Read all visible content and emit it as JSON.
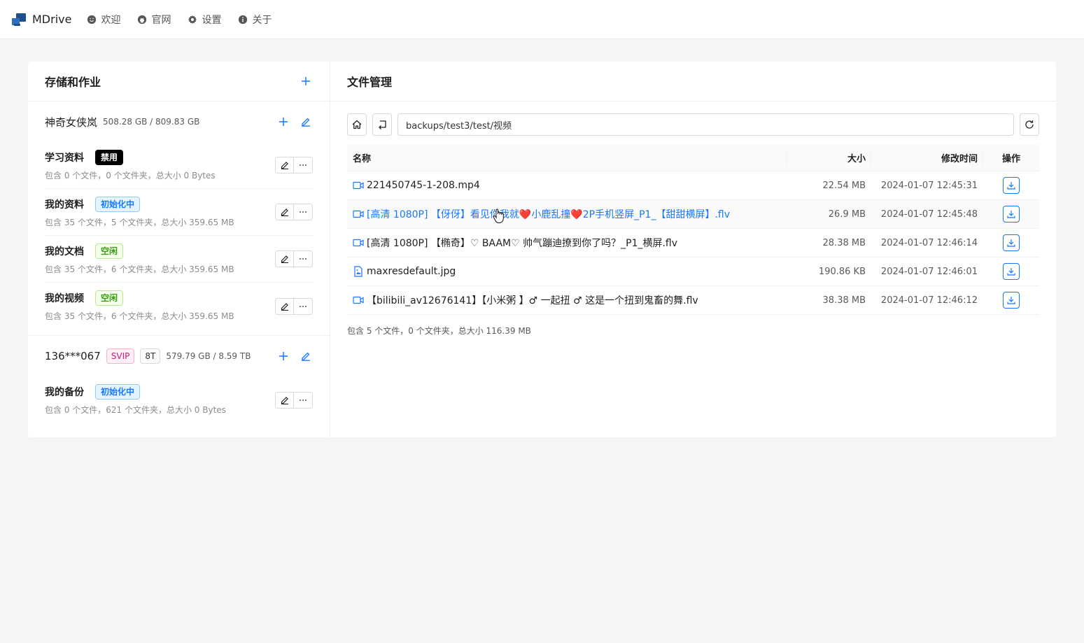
{
  "nav": {
    "brand": "MDrive",
    "items": [
      {
        "label": "欢迎",
        "icon": "smile-icon"
      },
      {
        "label": "官网",
        "icon": "github-icon"
      },
      {
        "label": "设置",
        "icon": "gear-icon"
      },
      {
        "label": "关于",
        "icon": "info-icon"
      }
    ]
  },
  "left": {
    "title": "存储和作业",
    "drives": [
      {
        "name": "神奇女侠岚",
        "size": "508.28 GB / 809.83 GB",
        "jobs": [
          {
            "name": "学习资料",
            "badge": "禁用",
            "desc": "包含 0 个文件，0 个文件夹，总大小 0 Bytes"
          },
          {
            "name": "我的资料",
            "badge": "初始化中",
            "desc": "包含 35 个文件，5 个文件夹，总大小 359.65 MB"
          },
          {
            "name": "我的文档",
            "badge": "空闲",
            "desc": "包含 35 个文件，6 个文件夹，总大小 359.65 MB"
          },
          {
            "name": "我的视频",
            "badge": "空闲",
            "desc": "包含 35 个文件，6 个文件夹，总大小 359.65 MB"
          }
        ]
      },
      {
        "name": "136***067",
        "tags": [
          "SVIP",
          "8T"
        ],
        "size": "579.79 GB / 8.59 TB",
        "jobs": [
          {
            "name": "我的备份",
            "badge": "初始化中",
            "desc": "包含 0 个文件，621 个文件夹，总大小 0 Bytes"
          }
        ]
      }
    ]
  },
  "right": {
    "title": "文件管理",
    "path": "backups/test3/test/视频",
    "columns": {
      "name": "名称",
      "size": "大小",
      "time": "修改时间",
      "op": "操作"
    },
    "files": [
      {
        "name": "221450745-1-208.mp4",
        "size": "22.54 MB",
        "time": "2024-01-07 12:45:31",
        "type": "video-icon"
      },
      {
        "name": "[高清 1080P] 【伢伢】看见你我就❤️小鹿乱撞❤️2P手机竖屏_P1_【甜甜横屏】.flv",
        "size": "26.9 MB",
        "time": "2024-01-07 12:45:48",
        "type": "video-icon"
      },
      {
        "name": "[高清 1080P] 【椭奇】♡ BAAM♡ 帅气蹦迪撩到你了吗？_P1_横屏.flv",
        "size": "28.38 MB",
        "time": "2024-01-07 12:46:14",
        "type": "video-icon"
      },
      {
        "name": "maxresdefault.jpg",
        "size": "190.86 KB",
        "time": "2024-01-07 12:46:01",
        "type": "image-file-icon"
      },
      {
        "name": "【bilibili_av12676141】【小米粥 】♂ 一起扭 ♂ 这是一个扭到鬼畜的舞.flv",
        "size": "38.38 MB",
        "time": "2024-01-07 12:46:12",
        "type": "video-icon"
      }
    ],
    "summary": "包含 5 个文件，0 个文件夹，总大小 116.39 MB"
  },
  "colors": {
    "accent": "#1677ff",
    "background": "#f5f5f5"
  }
}
